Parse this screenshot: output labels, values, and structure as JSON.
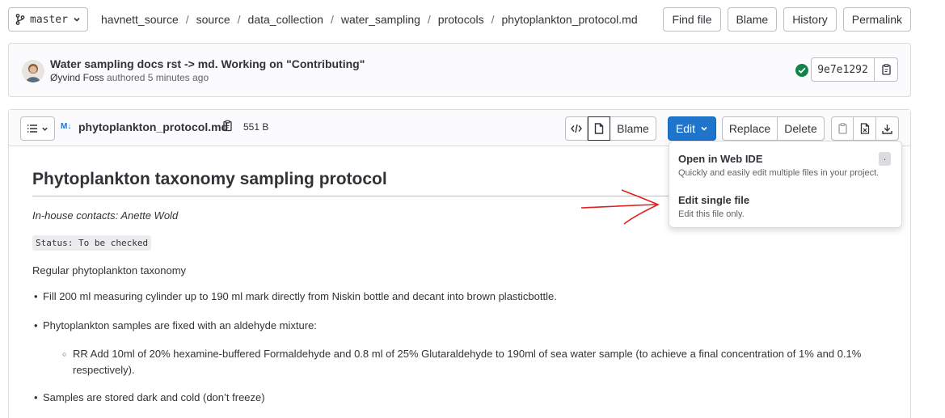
{
  "topbar": {
    "branch": "master",
    "breadcrumb": [
      "havnett_source",
      "source",
      "data_collection",
      "water_sampling",
      "protocols",
      "phytoplankton_protocol.md"
    ],
    "separator": "/",
    "actions": {
      "find_file": "Find file",
      "blame": "Blame",
      "history": "History",
      "permalink": "Permalink"
    }
  },
  "commit": {
    "title": "Water sampling docs rst -> md. Working on \"Contributing\"",
    "author": "Øyvind Foss",
    "authored_text": "authored 5 minutes ago",
    "sha": "9e7e1292",
    "pipeline_status": "passed",
    "status_color": "#108548"
  },
  "file": {
    "md_badge": "M↓",
    "name": "phytoplankton_protocol.md",
    "size": "551 B",
    "buttons": {
      "blame": "Blame",
      "edit": "Edit",
      "replace": "Replace",
      "delete": "Delete"
    },
    "accent_color": "#1f75cb"
  },
  "content": {
    "title": "Phytoplankton taxonomy sampling protocol",
    "contacts": "In-house contacts: Anette Wold",
    "status_code": "Status: To be checked",
    "intro": "Regular phytoplankton taxonomy",
    "bullets": [
      "Fill 200 ml measuring cylinder up to 190 ml mark directly from Niskin bottle and decant into brown plasticbottle.",
      "Phytoplankton samples are fixed with an aldehyde mixture:",
      "Samples are stored dark and cold (don’t freeze)"
    ],
    "sub_bullets": [
      "RR Add 10ml of 20% hexamine-buffered Formaldehyde and 0.8 ml of 25% Glutaraldehyde to 190ml of sea water sample (to achieve a final concentration of 1% and 0.1% respectively)."
    ]
  },
  "edit_menu": {
    "items": [
      {
        "title": "Open in Web IDE",
        "desc": "Quickly and easily edit multiple files in your project.",
        "shortcut": "."
      },
      {
        "title": "Edit single file",
        "desc": "Edit this file only."
      }
    ]
  },
  "annotation": {
    "arrow_color": "#e02020"
  }
}
